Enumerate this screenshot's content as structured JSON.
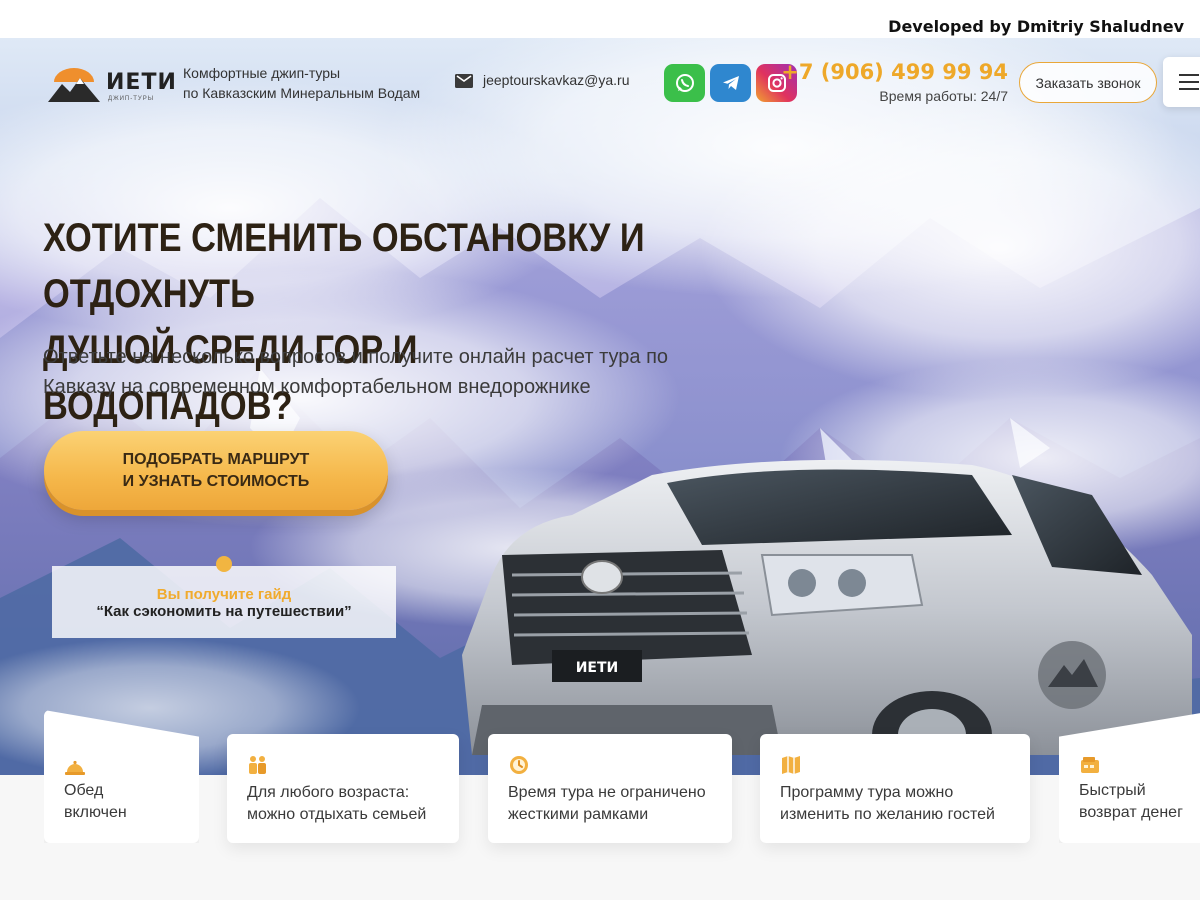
{
  "credit": {
    "text": "Developed by Dmitriy Shaludnev"
  },
  "header": {
    "logo_name": "ИЕТИ",
    "logo_sub": "ДЖИП-ТУРЫ",
    "tagline_line1": "Комфортные джип-туры",
    "tagline_line2": "по Кавказским Минеральным Водам",
    "email": "jeeptourskavkaz@ya.ru",
    "socials": [
      "whatsapp-icon",
      "telegram-icon",
      "instagram-icon"
    ],
    "phone": "+7 (906) 499 99 94",
    "hours": "Время работы: 24/7",
    "callback_label": "Заказать звонок"
  },
  "hero": {
    "headline_regular": "Хотите сменить обстановку и ",
    "headline_bold_1": "отдохнуть",
    "headline_bold_2": "душой среди гор и водопадов?",
    "subhead": "Ответьте на несколько вопросов и получите онлайн расчет тура по Кавказу на современном комфортабельном внедорожнике",
    "cta_label": "ПОДОБРАТЬ МАРШРУТ\nИ УЗНАТЬ СТОИМОСТЬ",
    "guide_line1": "Вы получите гайд",
    "guide_line2": "“Как сэкономить на путешествии”",
    "car_logo": "ИЕТИ"
  },
  "features": [
    {
      "icon": "cloche-icon",
      "text": "Обед\nвключен"
    },
    {
      "icon": "family-icon",
      "text": "Для любого возраста:\nможно отдыхать семьей"
    },
    {
      "icon": "clock-icon",
      "text": "Время тура не ограничено\nжесткими рамками"
    },
    {
      "icon": "map-icon",
      "text": "Программу тура можно\nизменить по желанию гостей"
    },
    {
      "icon": "wallet-icon",
      "text": "Быстрый\nвозврат денег"
    }
  ],
  "colors": {
    "accent": "#eea829",
    "cta": "#f5b74a",
    "headline": "#2d2214"
  }
}
